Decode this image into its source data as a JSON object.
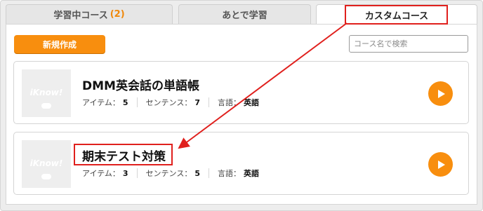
{
  "tabs": [
    {
      "label": "学習中コース",
      "count": "(2)"
    },
    {
      "label": "あとで学習"
    },
    {
      "label": "カスタムコース"
    }
  ],
  "toolbar": {
    "new_button": "新規作成",
    "search_placeholder": "コース名で検索"
  },
  "courses": [
    {
      "thumb_logo": "iKnow!",
      "title": "DMM英会話の単語帳",
      "items_label": "アイテム：",
      "items": "5",
      "sentences_label": "センテンス：",
      "sentences": "7",
      "language_label": "言語：",
      "language": "英語"
    },
    {
      "thumb_logo": "iKnow!",
      "title": "期末テスト対策",
      "items_label": "アイテム：",
      "items": "3",
      "sentences_label": "センテンス：",
      "sentences": "5",
      "language_label": "言語：",
      "language": "英語"
    }
  ],
  "colors": {
    "accent": "#f88e0e",
    "highlight": "#e0201d"
  }
}
